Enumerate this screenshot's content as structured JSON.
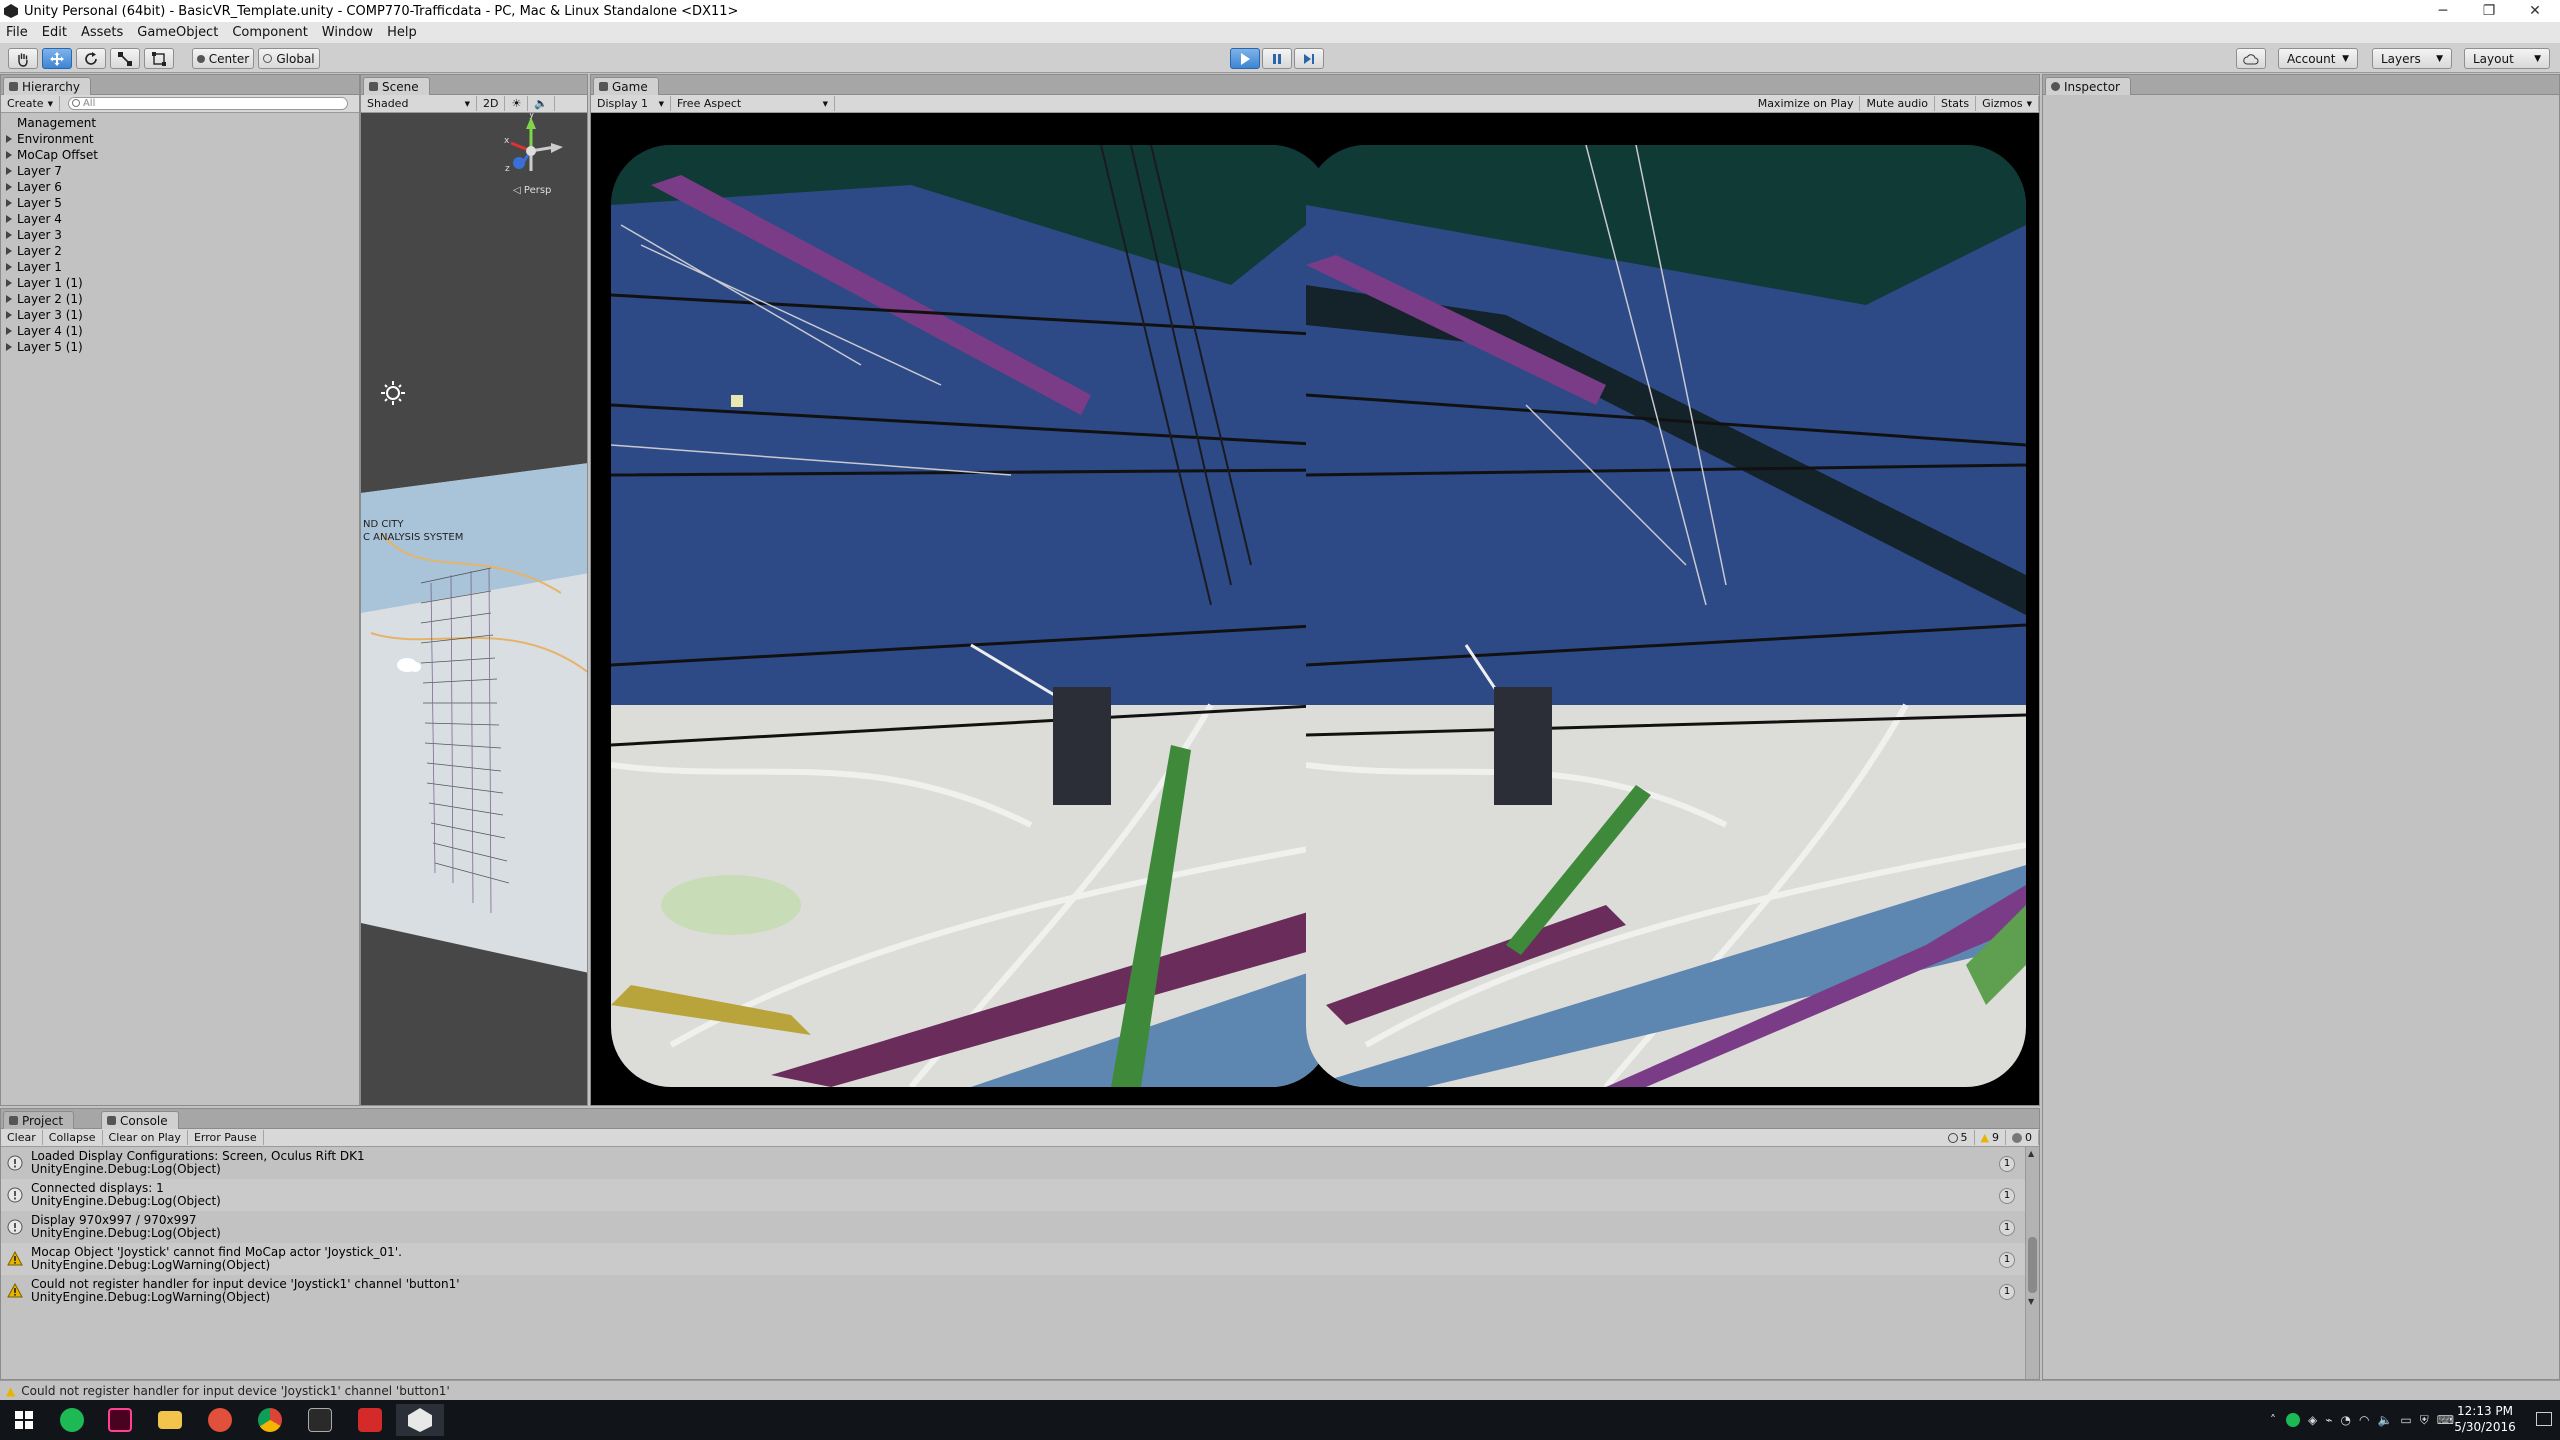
{
  "window": {
    "title": "Unity Personal (64bit) - BasicVR_Template.unity - COMP770-Trafficdata - PC, Mac & Linux Standalone <DX11>",
    "minimize": "─",
    "maximize": "❐",
    "close": "✕"
  },
  "menu": [
    "File",
    "Edit",
    "Assets",
    "GameObject",
    "Component",
    "Window",
    "Help"
  ],
  "toolbar": {
    "transform_tools": [
      "hand-tool",
      "move-tool",
      "rotate-tool",
      "scale-tool",
      "rect-tool"
    ],
    "pivot_label": "Center",
    "space_label": "Global",
    "play_state": "playing",
    "account_label": "Account",
    "layers_label": "Layers",
    "layout_label": "Layout"
  },
  "hierarchy": {
    "tab_label": "Hierarchy",
    "create_label": "Create",
    "search_placeholder": "All",
    "items": [
      {
        "label": "Management",
        "expandable": false
      },
      {
        "label": "Environment",
        "expandable": true
      },
      {
        "label": "MoCap Offset",
        "expandable": true
      },
      {
        "label": "Layer 7",
        "expandable": true
      },
      {
        "label": "Layer 6",
        "expandable": true
      },
      {
        "label": "Layer 5",
        "expandable": true
      },
      {
        "label": "Layer 4",
        "expandable": true
      },
      {
        "label": "Layer 3",
        "expandable": true
      },
      {
        "label": "Layer 2",
        "expandable": true
      },
      {
        "label": "Layer 1",
        "expandable": true
      },
      {
        "label": "Layer 1 (1)",
        "expandable": true
      },
      {
        "label": "Layer 2 (1)",
        "expandable": true
      },
      {
        "label": "Layer 3 (1)",
        "expandable": true
      },
      {
        "label": "Layer 4 (1)",
        "expandable": true
      },
      {
        "label": "Layer 5 (1)",
        "expandable": true
      }
    ]
  },
  "scene": {
    "tab_label": "Scene",
    "shading_mode": "Shaded",
    "mode_2d": "2D",
    "gizmo_y": "y",
    "gizmo_x": "x",
    "gizmo_z": "z",
    "persp_label": "Persp",
    "map_text_line1": "ND CITY",
    "map_text_line2": "C ANALYSIS SYSTEM"
  },
  "game": {
    "tab_label": "Game",
    "display_label": "Display 1",
    "aspect_label": "Free Aspect",
    "maximize_label": "Maximize on Play",
    "mute_label": "Mute audio",
    "stats_label": "Stats",
    "gizmos_label": "Gizmos"
  },
  "inspector": {
    "tab_label": "Inspector"
  },
  "bottom_tabs": {
    "project_label": "Project",
    "console_label": "Console"
  },
  "console": {
    "clear_label": "Clear",
    "collapse_label": "Collapse",
    "clear_on_play_label": "Clear on Play",
    "error_pause_label": "Error Pause",
    "info_count": "5",
    "warning_count": "9",
    "error_count": "0",
    "entries": [
      {
        "level": "info",
        "line1": "Loaded Display Configurations: Screen, Oculus Rift DK1",
        "line2": "UnityEngine.Debug:Log(Object)",
        "count": "1"
      },
      {
        "level": "info",
        "line1": "Connected displays: 1",
        "line2": "UnityEngine.Debug:Log(Object)",
        "count": "1"
      },
      {
        "level": "info",
        "line1": "Display 970x997 / 970x997",
        "line2": "UnityEngine.Debug:Log(Object)",
        "count": "1"
      },
      {
        "level": "warning",
        "line1": "Mocap Object 'Joystick' cannot find MoCap actor 'Joystick_01'.",
        "line2": "UnityEngine.Debug:LogWarning(Object)",
        "count": "1"
      },
      {
        "level": "warning",
        "line1": "Could not register handler for input device 'Joystick1' channel 'button1'",
        "line2": "UnityEngine.Debug:LogWarning(Object)",
        "count": "1"
      }
    ]
  },
  "status_message": "Could not register handler for input device 'Joystick1' channel 'button1'",
  "taskbar": {
    "apps": [
      "start-button",
      "spotify",
      "indesign",
      "file-explorer",
      "media-app",
      "chrome",
      "unity-app",
      "adobe-app",
      "unity-editor"
    ],
    "time": "12:13 PM",
    "date": "5/30/2016"
  },
  "colors": {
    "editor_bg": "#c2c2c2",
    "sky_blue": "#2d4a86",
    "play_accent": "#3d85d4",
    "warning_yellow": "#e8b400"
  }
}
